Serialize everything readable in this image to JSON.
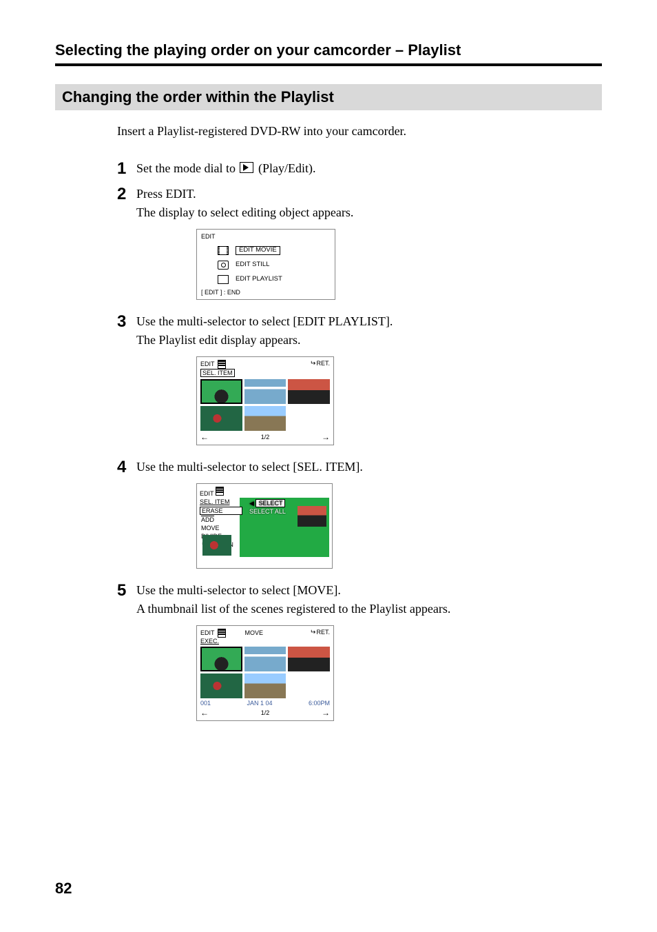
{
  "header": "Selecting the playing order on your camcorder – Playlist",
  "subsection": "Changing the order within the Playlist",
  "intro": "Insert a Playlist-registered DVD-RW into your camcorder.",
  "steps": {
    "s1": {
      "num": "1",
      "pre": "Set the mode dial to ",
      "post": " (Play/Edit)."
    },
    "s2": {
      "num": "2",
      "l1": "Press EDIT.",
      "l2": "The display to select editing object appears."
    },
    "s3": {
      "num": "3",
      "l1": "Use the multi-selector to select [EDIT PLAYLIST].",
      "l2": "The Playlist edit display appears."
    },
    "s4": {
      "num": "4",
      "l1": "Use the multi-selector to select [SEL. ITEM]."
    },
    "s5": {
      "num": "5",
      "l1": "Use the multi-selector to select [MOVE].",
      "l2": "A thumbnail list of the scenes registered to the Playlist appears."
    }
  },
  "panel_edit": {
    "title": "EDIT",
    "opt1": "EDIT MOVIE",
    "opt2": "EDIT STILL",
    "opt3": "EDIT PLAYLIST",
    "bottom": "[ EDIT ] : END"
  },
  "panel_playlist": {
    "title": "EDIT",
    "tab": "SEL. ITEM",
    "ret": "RET.",
    "pager": "1/2"
  },
  "panel_menu": {
    "title": "EDIT",
    "sub": "SEL. ITEM",
    "left": {
      "erase": "ERASE",
      "add": "ADD",
      "move": "MOVE",
      "divide": "DIVIDE",
      "return": "RETURN"
    },
    "right": {
      "select": "SELECT",
      "select_all": "SELECT ALL"
    }
  },
  "panel_move": {
    "title": "EDIT",
    "mode": "MOVE",
    "exec": "EXEC.",
    "ret": "RET.",
    "info_id": "001",
    "info_date": "JAN  1 04",
    "info_time": "6:00PM",
    "pager": "1/2"
  },
  "page_number": "82"
}
